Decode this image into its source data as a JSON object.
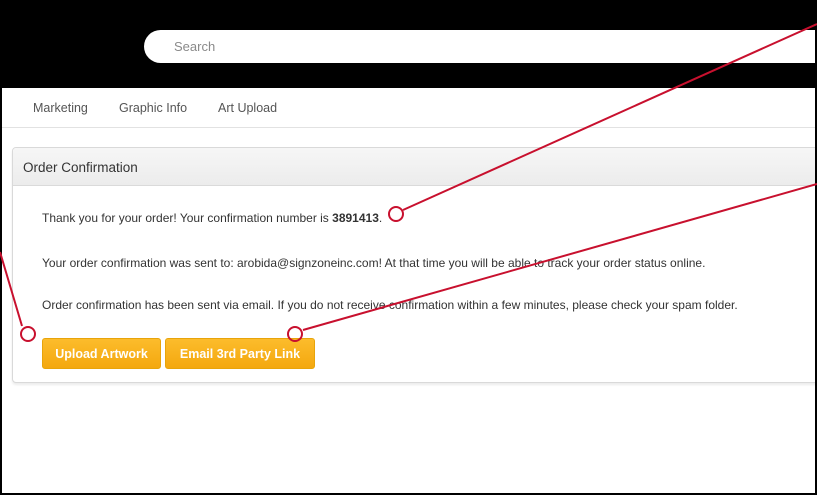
{
  "header": {
    "search_placeholder": "Search"
  },
  "subnav": {
    "items": [
      {
        "label": "Marketing"
      },
      {
        "label": "Graphic Info"
      },
      {
        "label": "Art Upload"
      }
    ]
  },
  "panel": {
    "title": "Order Confirmation",
    "thank_you_prefix": "Thank you for your order! Your confirmation number is ",
    "confirmation_number": "3891413",
    "thank_you_suffix": ".",
    "email_line": "Your order confirmation was sent to: arobida@signzoneinc.com! At that time you will be able to track your order status online.",
    "spam_line": "Order confirmation has been sent via email. If you do not receive confirmation within a few minutes, please check your spam folder.",
    "buttons": {
      "upload": "Upload Artwork",
      "email": "Email 3rd Party Link"
    }
  },
  "colors": {
    "button": "#f8b01c",
    "annotation": "#c8102e",
    "topbar": "#000000"
  }
}
